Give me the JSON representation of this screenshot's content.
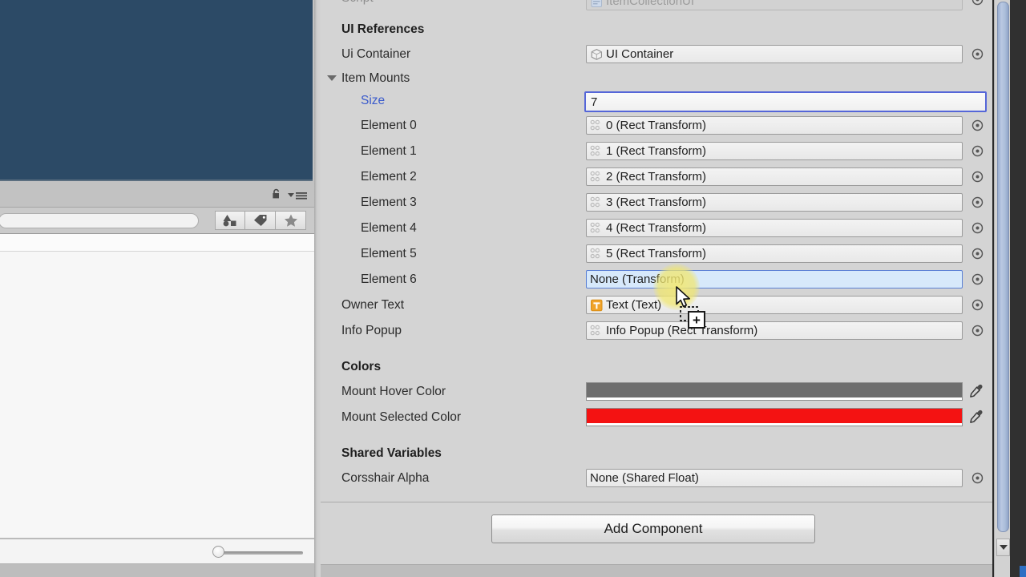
{
  "window": {
    "scene_view_color": "#2c4a66",
    "inspector_bg": "#d4d4d4"
  },
  "project_panel": {
    "search_placeholder": "",
    "search_value": "",
    "lock_icon": "lock-open-icon",
    "menu_icon": "hamburger-menu-icon",
    "filters": [
      {
        "name": "filter-by-type-icon",
        "label": ""
      },
      {
        "name": "filter-by-label-icon",
        "label": ""
      },
      {
        "name": "filter-favorites-icon",
        "label": ""
      }
    ],
    "zoom_slider": {
      "value": 8,
      "min": 0,
      "max": 100
    }
  },
  "inspector": {
    "script_row": {
      "label": "Script",
      "value": "ItemCollectionUI",
      "icon": "cs-script-icon",
      "disabled": true
    },
    "sections": [
      {
        "title": "UI References",
        "rows": [
          {
            "kind": "object",
            "label": "Ui Container",
            "value": "UI Container",
            "icon": "gameobject-cube-icon",
            "picker": true
          },
          {
            "kind": "foldout",
            "label": "Item Mounts",
            "expanded": true
          },
          {
            "kind": "size",
            "label": "Size",
            "value": "7",
            "focused": true
          },
          {
            "kind": "object",
            "label": "Element 0",
            "value": "0 (Rect Transform)",
            "icon": "rect-transform-icon",
            "indent": true,
            "picker": true
          },
          {
            "kind": "object",
            "label": "Element 1",
            "value": "1 (Rect Transform)",
            "icon": "rect-transform-icon",
            "indent": true,
            "picker": true
          },
          {
            "kind": "object",
            "label": "Element 2",
            "value": "2 (Rect Transform)",
            "icon": "rect-transform-icon",
            "indent": true,
            "picker": true
          },
          {
            "kind": "object",
            "label": "Element 3",
            "value": "3 (Rect Transform)",
            "icon": "rect-transform-icon",
            "indent": true,
            "picker": true
          },
          {
            "kind": "object",
            "label": "Element 4",
            "value": "4 (Rect Transform)",
            "icon": "rect-transform-icon",
            "indent": true,
            "picker": true
          },
          {
            "kind": "object",
            "label": "Element 5",
            "value": "5 (Rect Transform)",
            "icon": "rect-transform-icon",
            "indent": true,
            "picker": true
          },
          {
            "kind": "object",
            "label": "Element 6",
            "value": "None (Transform)",
            "icon": "none-icon",
            "indent": true,
            "picker": true,
            "dragover": true
          },
          {
            "kind": "object",
            "label": "Owner Text",
            "value": "Text (Text)",
            "icon": "text-component-icon",
            "picker": true
          },
          {
            "kind": "object",
            "label": "Info Popup",
            "value": "Info Popup (Rect Transform)",
            "icon": "rect-transform-icon",
            "picker": true
          }
        ]
      },
      {
        "title": "Colors",
        "rows": [
          {
            "kind": "color",
            "label": "Mount Hover Color",
            "color": "#6e6e6e",
            "alpha": "#ffffff"
          },
          {
            "kind": "color",
            "label": "Mount Selected Color",
            "color": "#f41212",
            "alpha": "#ffffff"
          }
        ]
      },
      {
        "title": "Shared Variables",
        "rows": [
          {
            "kind": "object",
            "label": "Corsshair Alpha",
            "value": "None (Shared Float)",
            "icon": "none-icon",
            "picker": true
          }
        ]
      }
    ],
    "add_component_label": "Add Component"
  },
  "scrollbar": {
    "thumb_position_pct": 0,
    "down_arrow_icon": "chevron-down-icon"
  },
  "cursor": {
    "drag_badge": "+",
    "state": "dragging-object-reference"
  }
}
